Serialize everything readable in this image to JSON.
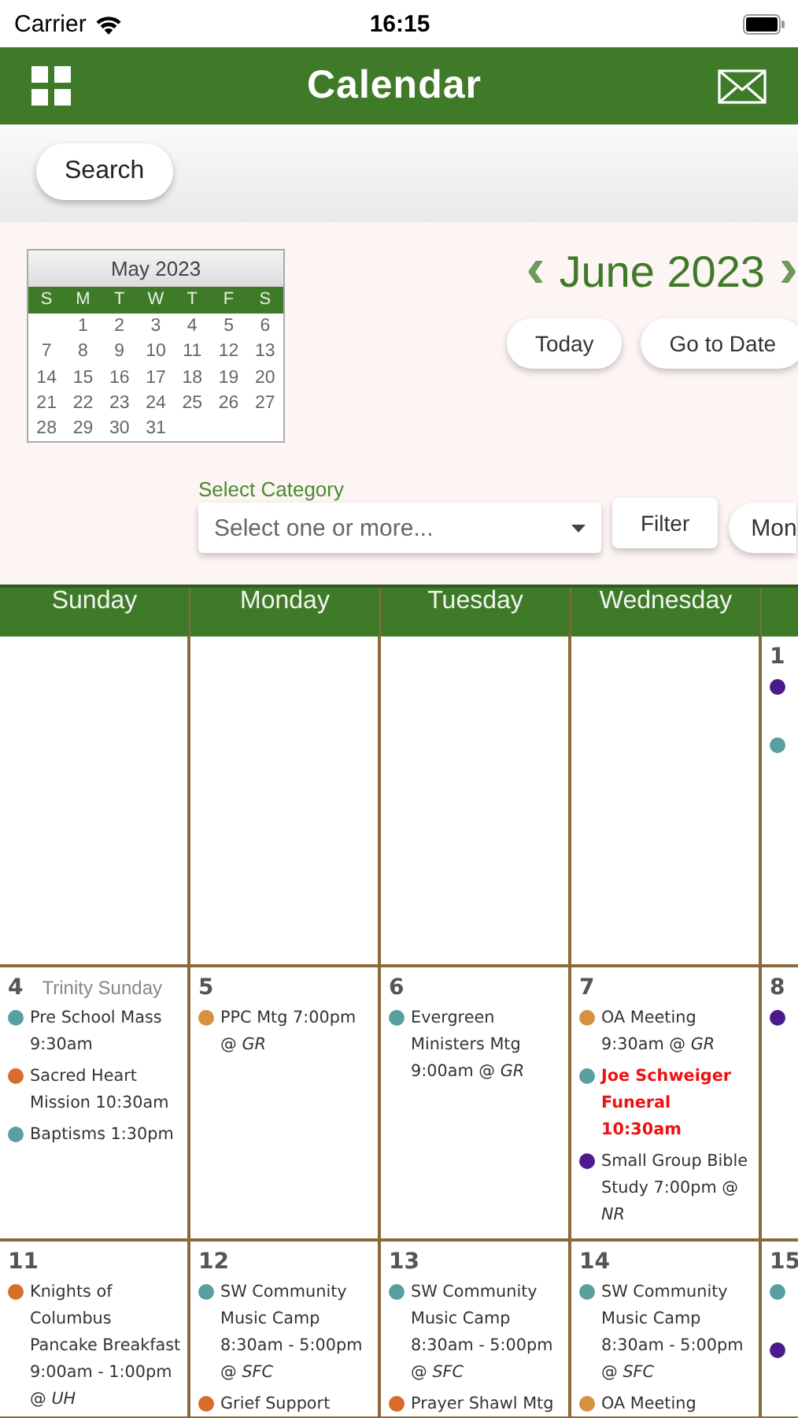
{
  "status_bar": {
    "carrier": "Carrier",
    "time": "16:15"
  },
  "nav": {
    "title": "Calendar"
  },
  "search": {
    "label": "Search"
  },
  "mini_calendar": {
    "title": "May 2023",
    "weekdays": [
      "S",
      "M",
      "T",
      "W",
      "T",
      "F",
      "S"
    ],
    "weeks": [
      [
        "1",
        "2",
        "3",
        "4",
        "5",
        "6"
      ],
      [
        "7",
        "8",
        "9",
        "10",
        "11",
        "12",
        "13"
      ],
      [
        "14",
        "15",
        "16",
        "17",
        "18",
        "19",
        "20"
      ],
      [
        "21",
        "22",
        "23",
        "24",
        "25",
        "26",
        "27"
      ],
      [
        "28",
        "29",
        "30",
        "31"
      ]
    ]
  },
  "month": {
    "title": "June 2023",
    "prev": "‹",
    "next": "›"
  },
  "buttons": [
    "Today",
    "Go to Date"
  ],
  "category": {
    "label": "Select Category",
    "placeholder": "Select one or more...",
    "filter": "Filter",
    "view": "Mon"
  },
  "weekdays": [
    "Sunday",
    "Monday",
    "Tuesday",
    "Wednesday"
  ],
  "weeks": [
    {
      "days": [
        {
          "kind": "blank"
        },
        {
          "kind": "blank"
        },
        {
          "kind": "blank"
        },
        {
          "kind": "blank"
        },
        {
          "kind": "day",
          "day": "1",
          "events": [
            {
              "color": "#4b1a8c"
            },
            {
              "color": "#5a9fa0"
            }
          ]
        }
      ]
    },
    {
      "days": [
        {
          "day": "4",
          "note": "Trinity Sunday",
          "events": [
            {
              "text": "Pre School Mass 9:30am",
              "color": "#5a9fa0"
            },
            {
              "text": "Sacred Heart Mission 10:30am",
              "color": "#d86c2a"
            },
            {
              "text": "Baptisms 1:30pm",
              "color": "#5a9fa0"
            }
          ]
        },
        {
          "day": "5",
          "events": [
            {
              "text": "PPC Mtg 7:00pm @ *GR*",
              "color": "#d6913f"
            }
          ]
        },
        {
          "day": "6",
          "events": [
            {
              "text": "Evergreen Ministers Mtg 9:00am @ *GR*",
              "color": "#5a9fa0"
            }
          ]
        },
        {
          "day": "7",
          "events": [
            {
              "text": "OA Meeting 9:30am @ *GR*",
              "color": "#d6913f"
            },
            {
              "text": "Joe Schweiger Funeral 10:30am",
              "color": "#5a9fa0",
              "emphasis": true
            },
            {
              "text": "Small Group Bible Study 7:00pm @ *NR*",
              "color": "#4b1a8c"
            }
          ]
        },
        {
          "day": "8",
          "events": [
            {
              "color": "#4b1a8c"
            }
          ]
        }
      ]
    },
    {
      "days": [
        {
          "day": "11",
          "events": [
            {
              "text": "Knights of Columbus Pancake Breakfast 9:00am - 1:00pm @ *UH*",
              "color": "#d86c2a"
            }
          ]
        },
        {
          "day": "12",
          "events": [
            {
              "text": "SW Community Music Camp 8:30am - 5:00pm @ *SFC*",
              "color": "#5a9fa0"
            },
            {
              "text": "Grief Support",
              "color": "#d86c2a"
            }
          ]
        },
        {
          "day": "13",
          "events": [
            {
              "text": "SW Community Music Camp 8:30am - 5:00pm @ *SFC*",
              "color": "#5a9fa0"
            },
            {
              "text": "Prayer Shawl Mtg",
              "color": "#d86c2a"
            }
          ]
        },
        {
          "day": "14",
          "events": [
            {
              "text": "SW Community Music Camp 8:30am - 5:00pm @ *SFC*",
              "color": "#5a9fa0"
            },
            {
              "text": "OA Meeting",
              "color": "#d6913f"
            }
          ]
        },
        {
          "day": "15",
          "events": [
            {
              "color": "#5a9fa0"
            },
            {
              "color": "#4b1a8c"
            }
          ]
        }
      ]
    }
  ]
}
